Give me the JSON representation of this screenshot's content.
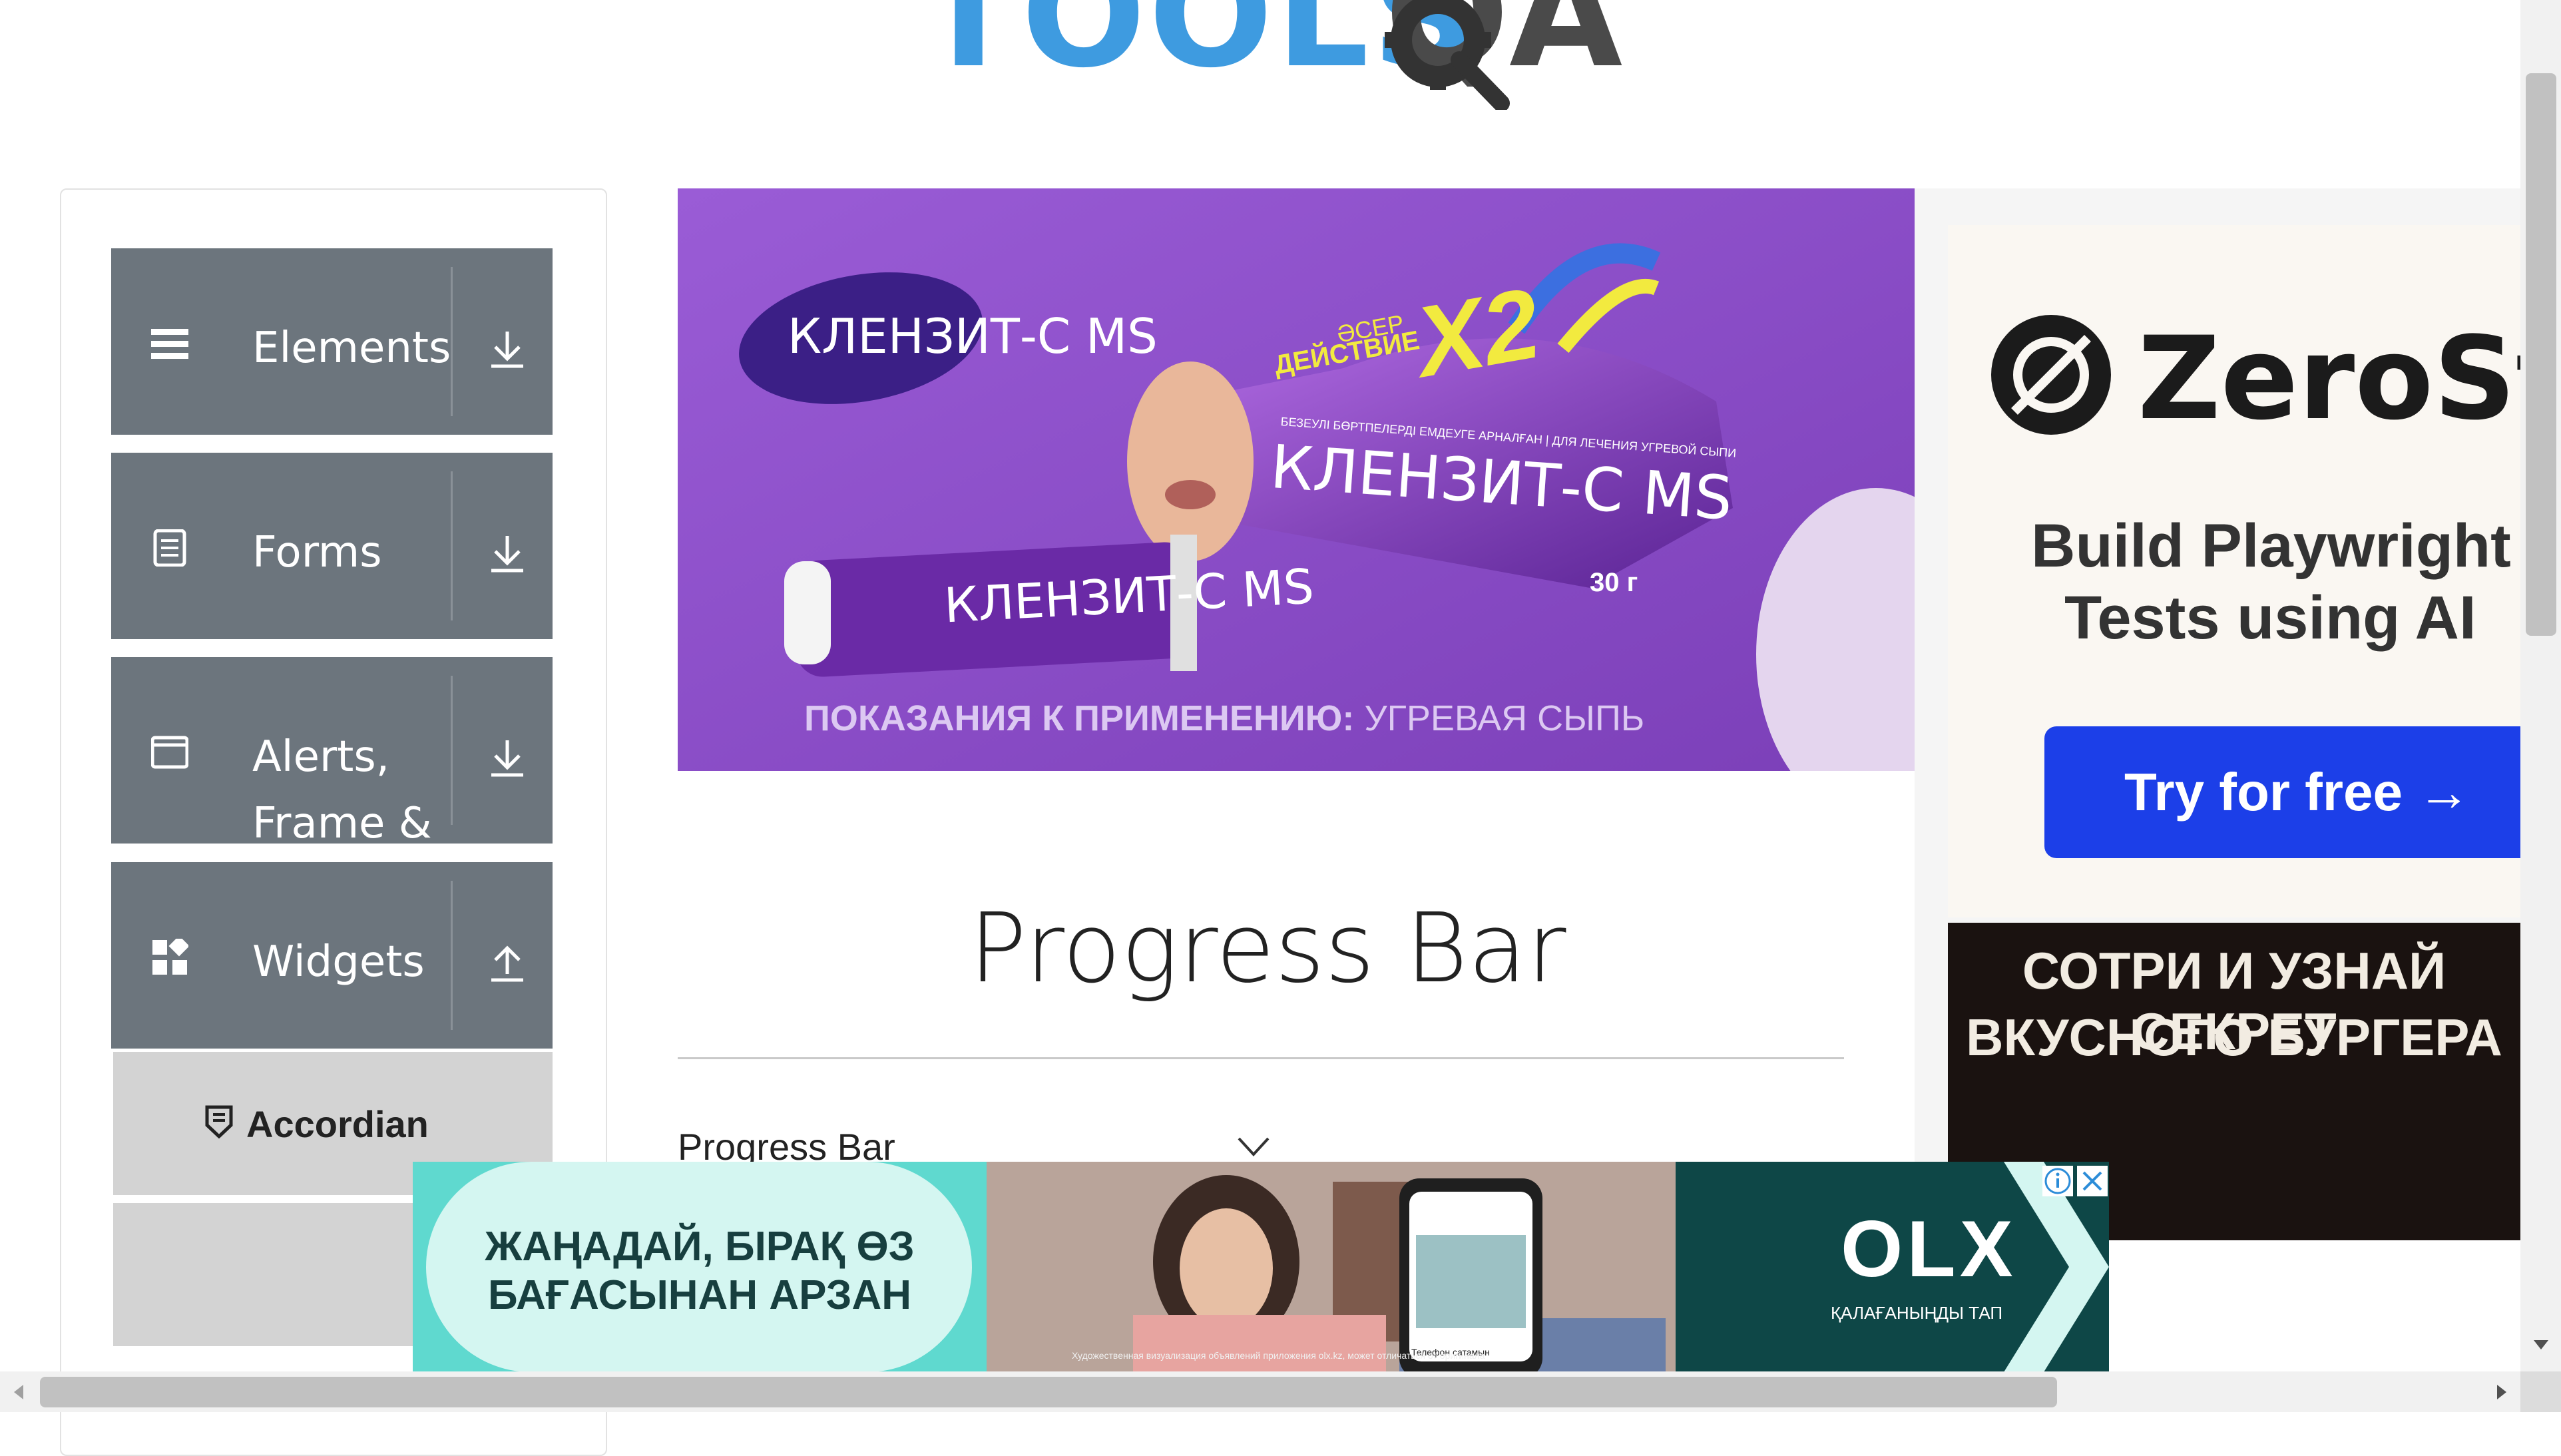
{
  "header": {
    "logo_text": "TOOLS",
    "logo_qa": "QA"
  },
  "sidebar": {
    "groups": [
      {
        "label": "Elements",
        "icon": "hamburger-icon",
        "arrow": "download-arrow-icon"
      },
      {
        "label": "Forms",
        "icon": "document-icon",
        "arrow": "download-arrow-icon"
      },
      {
        "label": "Alerts,\nFrame &\nWindows",
        "icon": "window-icon",
        "arrow": "download-arrow-icon"
      },
      {
        "label": "Widgets",
        "icon": "widgets-icon",
        "arrow": "upload-arrow-icon"
      }
    ],
    "subitems": [
      {
        "label": "Accordian",
        "icon": "shield-icon"
      }
    ]
  },
  "hero_ad": {
    "brand": "КЛЕНЗИТ-С MS",
    "badge_top": "ӘСЕР",
    "badge_mid": "ДЕЙСТВИЕ",
    "badge_mult": "X2",
    "box_caption": "БЕЗЕУЛІ БӨРТПЕЛЕРДІ ЕМДЕУГЕ АРНАЛҒАН | ДЛЯ ЛЕЧЕНИЯ УГРЕВОЙ СЫПИ",
    "tube_label": "КЛЕНЗИТ-С MS",
    "box_label": "КЛЕНЗИТ-С MS",
    "weight": "30 г",
    "indications_bold": "ПОКАЗАНИЯ К ПРИМЕНЕНИЮ:",
    "indications_rest": "УГРЕВАЯ СЫПЬ"
  },
  "side_ad": {
    "brand": "ZeroStep",
    "headline_1": "Build Playwright",
    "headline_2": "Tests using AI",
    "cta": "Try for free →",
    "banner_1": "СОТРИ И УЗНАЙ СЕКРЕТ",
    "banner_2": "ВКУСНОГО БУРГЕРА"
  },
  "main": {
    "title": "Progress Bar",
    "selected_option": "Progress Bar"
  },
  "bottom_ad": {
    "headline_1": "ЖАҢАДАЙ, БІРАҚ ӨЗ",
    "headline_2": "БАҒАСЫНАН АРЗАН",
    "brand": "OLX",
    "tagline": "ҚАЛАҒАНЫҢДЫ ТАП",
    "disclaimer": "Художественная визуализация объявлений приложения olx.kz, может отличаться от оригинала",
    "phone_caption": "Телефон сатамын",
    "info_icon": "info-icon",
    "close_icon": "close-icon"
  },
  "colors": {
    "sidebar_group_bg": "#6c757d",
    "sidebar_sub_bg": "#d3d3d3",
    "ad_purple": "#8e4fc7",
    "cta_blue": "#1c3fe8",
    "olx_teal": "#0e4747",
    "olx_mint": "#a9ece5"
  }
}
